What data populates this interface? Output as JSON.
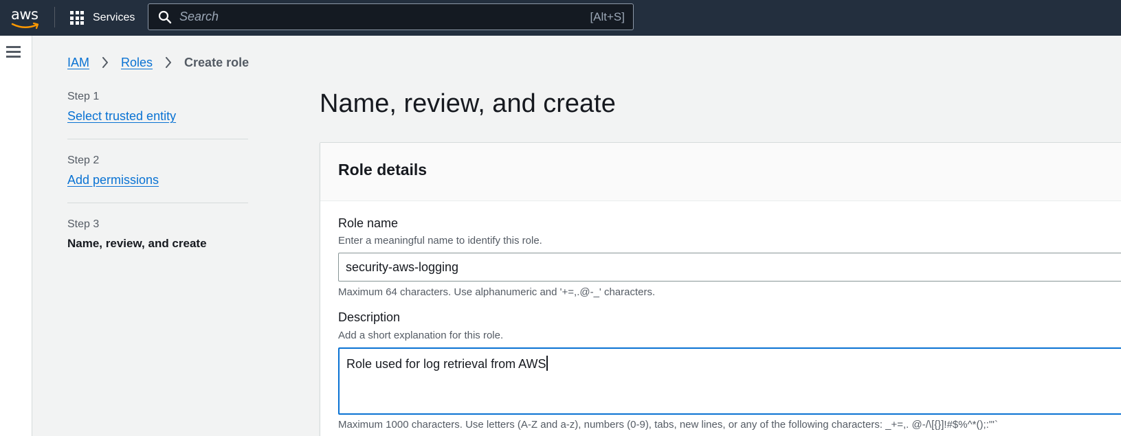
{
  "topnav": {
    "logo_text": "aws",
    "services_label": "Services",
    "search_placeholder": "Search",
    "search_shortcut": "[Alt+S]"
  },
  "breadcrumb": {
    "items": [
      "IAM",
      "Roles"
    ],
    "current": "Create role"
  },
  "steps": [
    {
      "label": "Step 1",
      "title": "Select trusted entity"
    },
    {
      "label": "Step 2",
      "title": "Add permissions"
    },
    {
      "label": "Step 3",
      "title": "Name, review, and create"
    }
  ],
  "main": {
    "page_title": "Name, review, and create",
    "panel_title": "Role details",
    "role_name": {
      "label": "Role name",
      "description": "Enter a meaningful name to identify this role.",
      "value": "security-aws-logging",
      "constraint": "Maximum 64 characters. Use alphanumeric and '+=,.@-_' characters."
    },
    "description_field": {
      "label": "Description",
      "description": "Add a short explanation for this role.",
      "value": "Role used for log retrieval from AWS",
      "constraint": "Maximum 1000 characters. Use letters (A-Z and a-z), numbers (0-9), tabs, new lines, or any of the following characters: _+=,. @-/\\[{}]!#$%^*();:\"'`"
    }
  },
  "colors": {
    "nav_bg": "#232f3e",
    "link": "#0972d3",
    "focus_border": "#0972d3"
  }
}
